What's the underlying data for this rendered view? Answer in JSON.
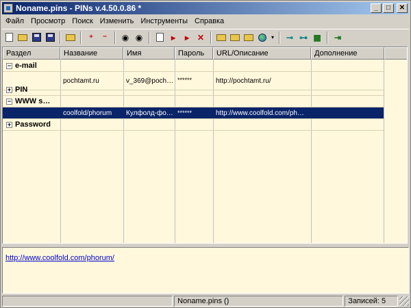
{
  "window": {
    "title": "Noname.pins - PINs v.4.50.0.86 *"
  },
  "window_buttons": {
    "minimize": "_",
    "maximize": "□",
    "close": "✕"
  },
  "menu": [
    {
      "label": "Файл"
    },
    {
      "label": "Просмотр"
    },
    {
      "label": "Поиск"
    },
    {
      "label": "Изменить"
    },
    {
      "label": "Инструменты"
    },
    {
      "label": "Справка"
    }
  ],
  "toolbar": {
    "icons": [
      "new-icon",
      "open-icon",
      "save-icon",
      "save-as-icon",
      "open-folder-icon",
      "add-section-icon",
      "delete-section-icon",
      "find-icon",
      "find-next-icon",
      "edit-icon",
      "add-item-icon",
      "add-subitem-icon",
      "delete-item-icon",
      "copy-name-icon",
      "copy-user-icon",
      "copy-password-icon",
      "browser-icon",
      "key-icon",
      "keys-icon",
      "password-gen-icon",
      "exit-icon"
    ]
  },
  "grid": {
    "columns": [
      "Раздел",
      "Название",
      "Имя",
      "Пароль",
      "URL/Описание",
      "Дополнение"
    ],
    "rows": [
      {
        "kind": "group",
        "expander": "−",
        "section": "e-mail"
      },
      {
        "kind": "item",
        "name": "pochtamt.ru",
        "user": "v_369@poch…",
        "password": "******",
        "url": "http://pochtamt.ru/",
        "extra": ""
      },
      {
        "kind": "group",
        "expander": "+",
        "section": "PIN"
      },
      {
        "kind": "group",
        "expander": "−",
        "section": "WWW s…"
      },
      {
        "kind": "item",
        "selected": true,
        "name": "coolfold/phorum",
        "user": "Кулфолд-фо…",
        "password": "******",
        "url": "http://www.coolfold.com/ph…",
        "extra": ""
      },
      {
        "kind": "group",
        "expander": "+",
        "section": "Password"
      }
    ]
  },
  "memo": {
    "link": "http://www.coolfold.com/phorum/"
  },
  "status": {
    "file": "Noname.pins ()",
    "records": "Записей: 5"
  }
}
